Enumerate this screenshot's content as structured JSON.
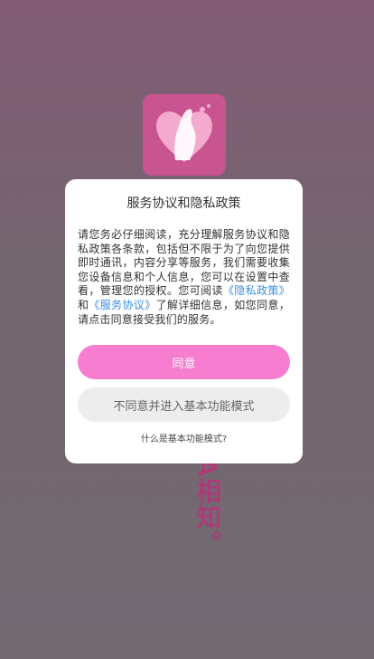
{
  "background": {
    "accent": "#c8558f",
    "slogan": "A相知。"
  },
  "dialog": {
    "title": "服务协议和隐私政策",
    "body": {
      "part1": "请您务必仔细阅读，充分理解服务协议和隐私政策各条款，包括但不限于为了向您提供即时通讯，内容分享等服务，我们需要收集您设备信息和个人信息，您可以在设置中查看，管理您的授权。您可阅读",
      "privacy_link": "《隐私政策》",
      "and": "和",
      "service_link": "《服务协议》",
      "part2": "了解详细信息，如您同意，请点击同意接受我们的服务。"
    },
    "agree_label": "同意",
    "disagree_label": "不同意并进入基本功能模式",
    "basic_mode_hint": "什么是基本功能模式?"
  },
  "colors": {
    "agree_button": "#f77dd0",
    "link": "#3a8ee6"
  }
}
